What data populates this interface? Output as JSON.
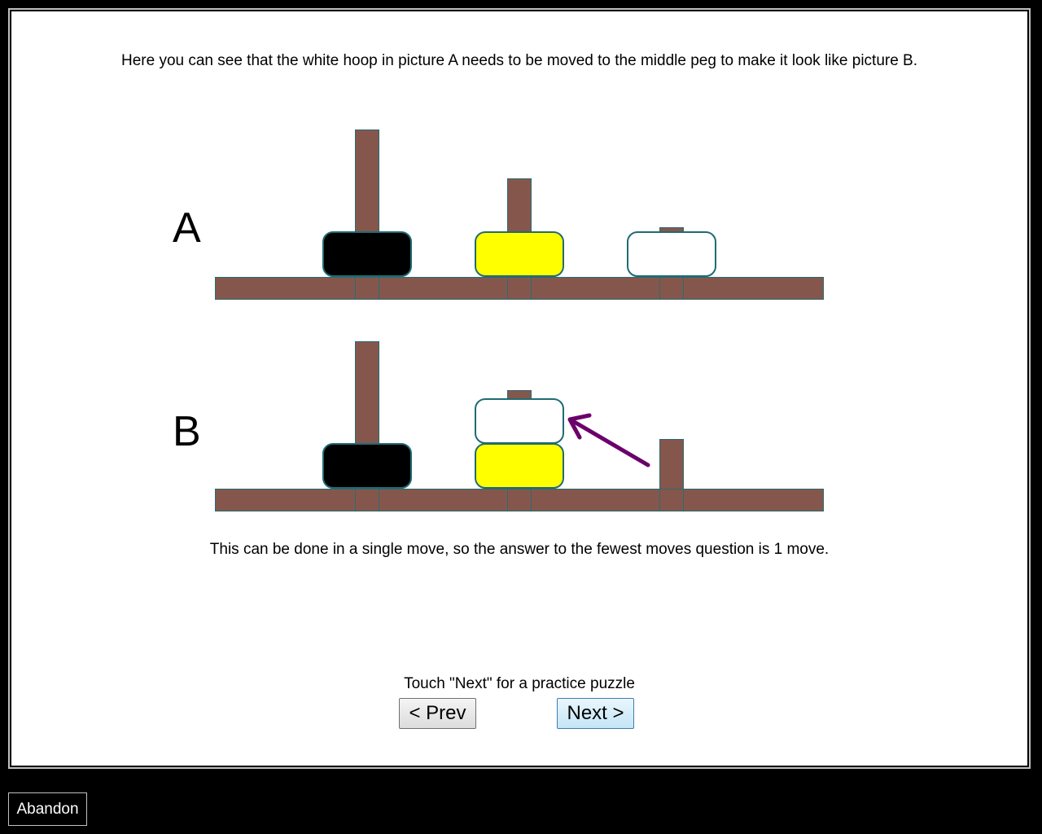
{
  "instructions": {
    "intro": "Here you can see that the white hoop in picture A needs to be moved to the middle peg to make it look like picture B.",
    "summary": "This can be done in a single move, so the answer to the fewest moves question is 1 move.",
    "touch_next": "Touch \"Next\" for a practice puzzle"
  },
  "picture_a": {
    "label": "A",
    "pegs": [
      {
        "hoops": [
          "black"
        ]
      },
      {
        "hoops": [
          "yellow"
        ]
      },
      {
        "hoops": [
          "white"
        ]
      }
    ]
  },
  "picture_b": {
    "label": "B",
    "pegs": [
      {
        "hoops": [
          "black"
        ]
      },
      {
        "hoops": [
          "yellow",
          "white"
        ]
      },
      {
        "hoops": []
      }
    ]
  },
  "colors": {
    "peg": "#85574c",
    "hoop_outline": "#1f6b74",
    "black_hoop": "#000000",
    "yellow_hoop": "#ffff00",
    "white_hoop": "#ffffff",
    "arrow": "#6b006b"
  },
  "buttons": {
    "prev": "< Prev",
    "next": "Next >",
    "abandon": "Abandon"
  }
}
